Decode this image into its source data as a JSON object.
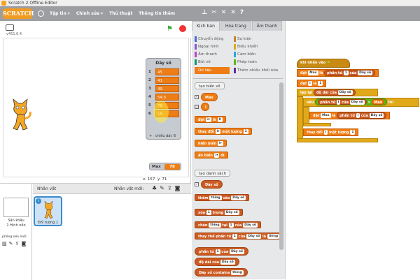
{
  "window": {
    "title": "Scratch 2 Offline Editor"
  },
  "menubar": {
    "logo": "SCRATCH",
    "items": [
      "Tập tin ▾",
      "Chỉnh sửa ▾",
      "Thủ thuật",
      "Thông tin thêm"
    ]
  },
  "stage": {
    "version": "v451.0.4",
    "list_monitor": {
      "title": "Dãy số",
      "items": [
        {
          "index": "1",
          "value": "45"
        },
        {
          "index": "2",
          "value": "41"
        },
        {
          "index": "3",
          "value": "49"
        },
        {
          "index": "4",
          "value": "54.5"
        },
        {
          "index": "5",
          "value": "78"
        },
        {
          "index": "6",
          "value": "15"
        }
      ],
      "footer_plus": "+",
      "footer_len": "chiều dài: 6"
    },
    "var_monitor": {
      "label": "Max",
      "value": "78"
    },
    "coords": {
      "x_label": "x:",
      "x": "157",
      "y_label": "y:",
      "y": "71"
    }
  },
  "sprites": {
    "header": "Nhân vật",
    "new_sprite": "Nhân vật mới:",
    "stage_label": "Sân khấu",
    "stage_sub": "1 Hình nền",
    "new_backdrop": "phông nền mới:",
    "sprite_name": "Đối tượng 1"
  },
  "palette": {
    "tabs": [
      "Kịch bản",
      "Hóa trang",
      "Âm thanh"
    ],
    "categories_left": [
      {
        "label": "Chuyển động",
        "color": "#4a6cd4"
      },
      {
        "label": "Ngoại hình",
        "color": "#8a55d7"
      },
      {
        "label": "Âm thanh",
        "color": "#bb42c3"
      },
      {
        "label": "Bút vẽ",
        "color": "#0e9a6c"
      },
      {
        "label": "Dữ liệu",
        "color": "#ee7d16"
      }
    ],
    "categories_right": [
      {
        "label": "Sự kiện",
        "color": "#c88330"
      },
      {
        "label": "Điều khiển",
        "color": "#e1a91a"
      },
      {
        "label": "Cảm biến",
        "color": "#2ca5e2"
      },
      {
        "label": "Phép toán",
        "color": "#5cb712"
      },
      {
        "label": "Thêm nhiều khối nữa",
        "color": "#632d99"
      }
    ],
    "make_var": "tạo biến số",
    "var_max": "Max",
    "var_i": "i",
    "blk_set": "đặt",
    "blk_set_to": "là",
    "blk_set_val": "0",
    "blk_change": "thay đổi",
    "blk_change_by": "một lượng",
    "blk_change_val": "1",
    "blk_show": "hiển biến",
    "blk_hide": "ẩn biến",
    "blk_hide_suffix": "đi",
    "make_list": "tạo danh sách",
    "list_name": "Dãy số",
    "blk_add": "thêm",
    "blk_add_val": "thing",
    "blk_add_to": "vào",
    "blk_del": "xóa",
    "blk_del_of": "trong",
    "blk_insert": "chèn",
    "blk_insert_at": "tại",
    "blk_insert_of": "của",
    "blk_replace": "thay thế phần tử",
    "blk_replace_of": "của",
    "blk_replace_with": "là",
    "blk_item": "phần tử",
    "blk_item_of": "của",
    "blk_length": "độ dài của",
    "blk_contains": "contains",
    "one": "1"
  },
  "script": {
    "hat": "khi nhấn vào",
    "set1_a": "đặt",
    "set1_b": "là",
    "set1_c": "phần tử",
    "set1_d": "của",
    "set2_a": "đặt",
    "set2_b": "là",
    "repeat": "lặp lại",
    "repeat_arg": "độ dài của",
    "if": "nếu",
    "if_item": "phần tử",
    "if_of": "của",
    "gt": ">",
    "then": "thì",
    "inner_set_a": "đặt",
    "inner_set_b": "là",
    "inner_set_c": "phần tử",
    "inner_set_d": "của",
    "change_a": "thay đổi",
    "change_b": "một lượng",
    "var_max": "Max",
    "var_i": "i",
    "list": "Dãy số",
    "one": "1"
  }
}
